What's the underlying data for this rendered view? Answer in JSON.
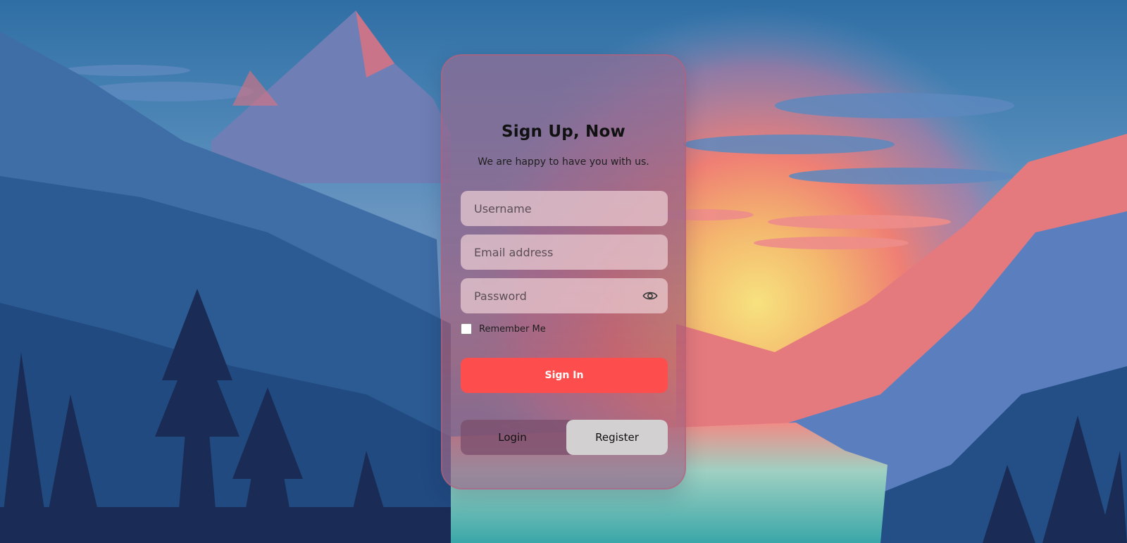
{
  "form": {
    "title": "Sign Up, Now",
    "subtitle": "We are happy to have you with us.",
    "username_placeholder": "Username",
    "email_placeholder": "Email address",
    "password_placeholder": "Password",
    "remember_label": "Remember Me",
    "remember_checked": false,
    "submit_label": "Sign In",
    "toggle": {
      "login_label": "Login",
      "register_label": "Register",
      "active": "Register"
    }
  },
  "icons": {
    "password_toggle": "eye-icon"
  },
  "colors": {
    "accent": "#fd4d4d",
    "toggle_active": "#d3d0d1"
  }
}
